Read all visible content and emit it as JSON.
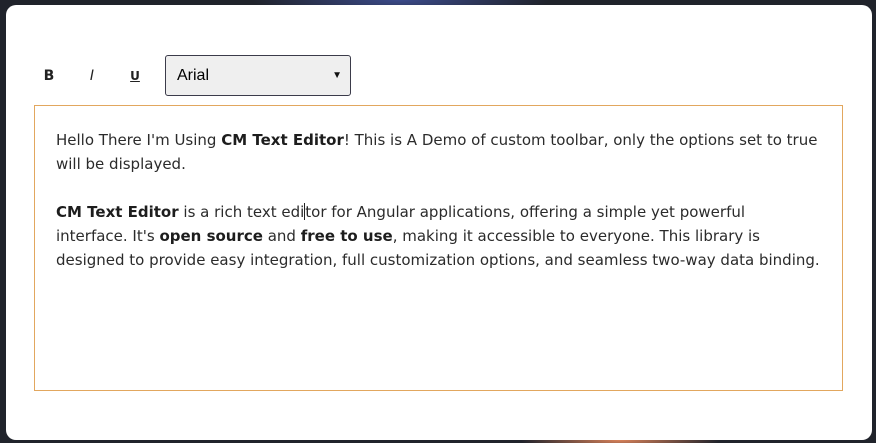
{
  "toolbar": {
    "bold_label": "B",
    "italic_label": "I",
    "underline_label": "U",
    "font_select": {
      "selected": "Arial",
      "options": [
        "Arial"
      ]
    }
  },
  "editor": {
    "p1": {
      "t1": "Hello There I'm Using ",
      "b1": "CM Text Editor",
      "t2": "!  This is A Demo of custom toolbar, only the options set to true will be displayed."
    },
    "p2": {
      "b1": "CM Text Editor",
      "t1a": " is a rich text edi",
      "t1b": "tor for Angular applications, offering a simple yet powerful interface. It's ",
      "b2": "open source",
      "t2": " and ",
      "b3": "free to use",
      "t3": ", making it accessible to everyone. This library is designed to provide easy integration, full customization options, and seamless two-way data binding."
    }
  },
  "colors": {
    "editor_border": "#e2a75e",
    "background": "#20232b",
    "card": "#ffffff"
  }
}
